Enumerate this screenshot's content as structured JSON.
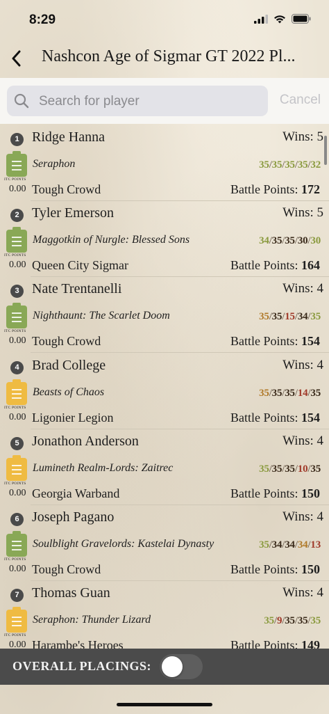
{
  "status": {
    "time": "8:29"
  },
  "nav": {
    "title": "Nashcon Age of Sigmar GT 2022 Pl..."
  },
  "search": {
    "placeholder": "Search for player",
    "value": "",
    "cancel_label": "Cancel"
  },
  "itc_label": "ITC POINTS",
  "entries": [
    {
      "rank": "1",
      "name": "Ridge Hanna",
      "wins": "Wins: 5",
      "faction": "Seraphon",
      "clip": "green",
      "scores": [
        [
          "35",
          "g"
        ],
        [
          "35",
          "g"
        ],
        [
          "35",
          "g"
        ],
        [
          "35",
          "g"
        ],
        [
          "32",
          "g"
        ]
      ],
      "itc": "0.00",
      "club": "Tough Crowd",
      "bp_label": "Battle Points: ",
      "bp": "172"
    },
    {
      "rank": "2",
      "name": "Tyler Emerson",
      "wins": "Wins: 5",
      "faction": "Maggotkin of Nurgle: Blessed Sons",
      "clip": "green",
      "scores": [
        [
          "34",
          "g"
        ],
        [
          "35",
          "b"
        ],
        [
          "35",
          "b"
        ],
        [
          "30",
          "b"
        ],
        [
          "30",
          "g"
        ]
      ],
      "itc": "0.00",
      "club": "Queen City Sigmar",
      "bp_label": "Battle Points: ",
      "bp": "164"
    },
    {
      "rank": "3",
      "name": "Nate Trentanelli",
      "wins": "Wins: 4",
      "faction": "Nighthaunt: The Scarlet Doom",
      "clip": "green",
      "scores": [
        [
          "35",
          "o"
        ],
        [
          "35",
          "b"
        ],
        [
          "15",
          "r"
        ],
        [
          "34",
          "b"
        ],
        [
          "35",
          "g"
        ]
      ],
      "itc": "0.00",
      "club": "Tough Crowd",
      "bp_label": "Battle Points: ",
      "bp": "154"
    },
    {
      "rank": "4",
      "name": "Brad College",
      "wins": "Wins: 4",
      "faction": "Beasts of Chaos",
      "clip": "yellow",
      "scores": [
        [
          "35",
          "o"
        ],
        [
          "35",
          "b"
        ],
        [
          "35",
          "b"
        ],
        [
          "14",
          "r"
        ],
        [
          "35",
          "b"
        ]
      ],
      "itc": "0.00",
      "club": "Ligonier Legion",
      "bp_label": "Battle Points: ",
      "bp": "154"
    },
    {
      "rank": "5",
      "name": "Jonathon Anderson",
      "wins": "Wins: 4",
      "faction": "Lumineth Realm-Lords: Zaitrec",
      "clip": "yellow",
      "scores": [
        [
          "35",
          "g"
        ],
        [
          "35",
          "b"
        ],
        [
          "35",
          "b"
        ],
        [
          "10",
          "r"
        ],
        [
          "35",
          "b"
        ]
      ],
      "itc": "0.00",
      "club": "Georgia Warband",
      "bp_label": "Battle Points: ",
      "bp": "150"
    },
    {
      "rank": "6",
      "name": "Joseph Pagano",
      "wins": "Wins: 4",
      "faction": "Soulblight Gravelords: Kastelai Dynasty",
      "clip": "green",
      "scores": [
        [
          "35",
          "g"
        ],
        [
          "34",
          "b"
        ],
        [
          "34",
          "b"
        ],
        [
          "34",
          "o"
        ],
        [
          "13",
          "r"
        ]
      ],
      "itc": "0.00",
      "club": "Tough Crowd",
      "bp_label": "Battle Points: ",
      "bp": "150"
    },
    {
      "rank": "7",
      "name": "Thomas Guan",
      "wins": "Wins: 4",
      "faction": "Seraphon: Thunder Lizard",
      "clip": "yellow",
      "scores": [
        [
          "35",
          "g"
        ],
        [
          "9",
          "r"
        ],
        [
          "35",
          "b"
        ],
        [
          "35",
          "b"
        ],
        [
          "35",
          "g"
        ]
      ],
      "itc": "0.00",
      "club": "Harambe's Heroes",
      "bp_label": "Battle Points: ",
      "bp": "149"
    }
  ],
  "bottom": {
    "overall_label": "OVERALL PLACINGS:",
    "toggle_on": false
  },
  "colors": {
    "green_clip": "#89a856",
    "yellow_clip": "#efbb42",
    "score_green": "#8a9a3e",
    "score_red": "#a03a2a",
    "bar": "#4b4b4b"
  }
}
